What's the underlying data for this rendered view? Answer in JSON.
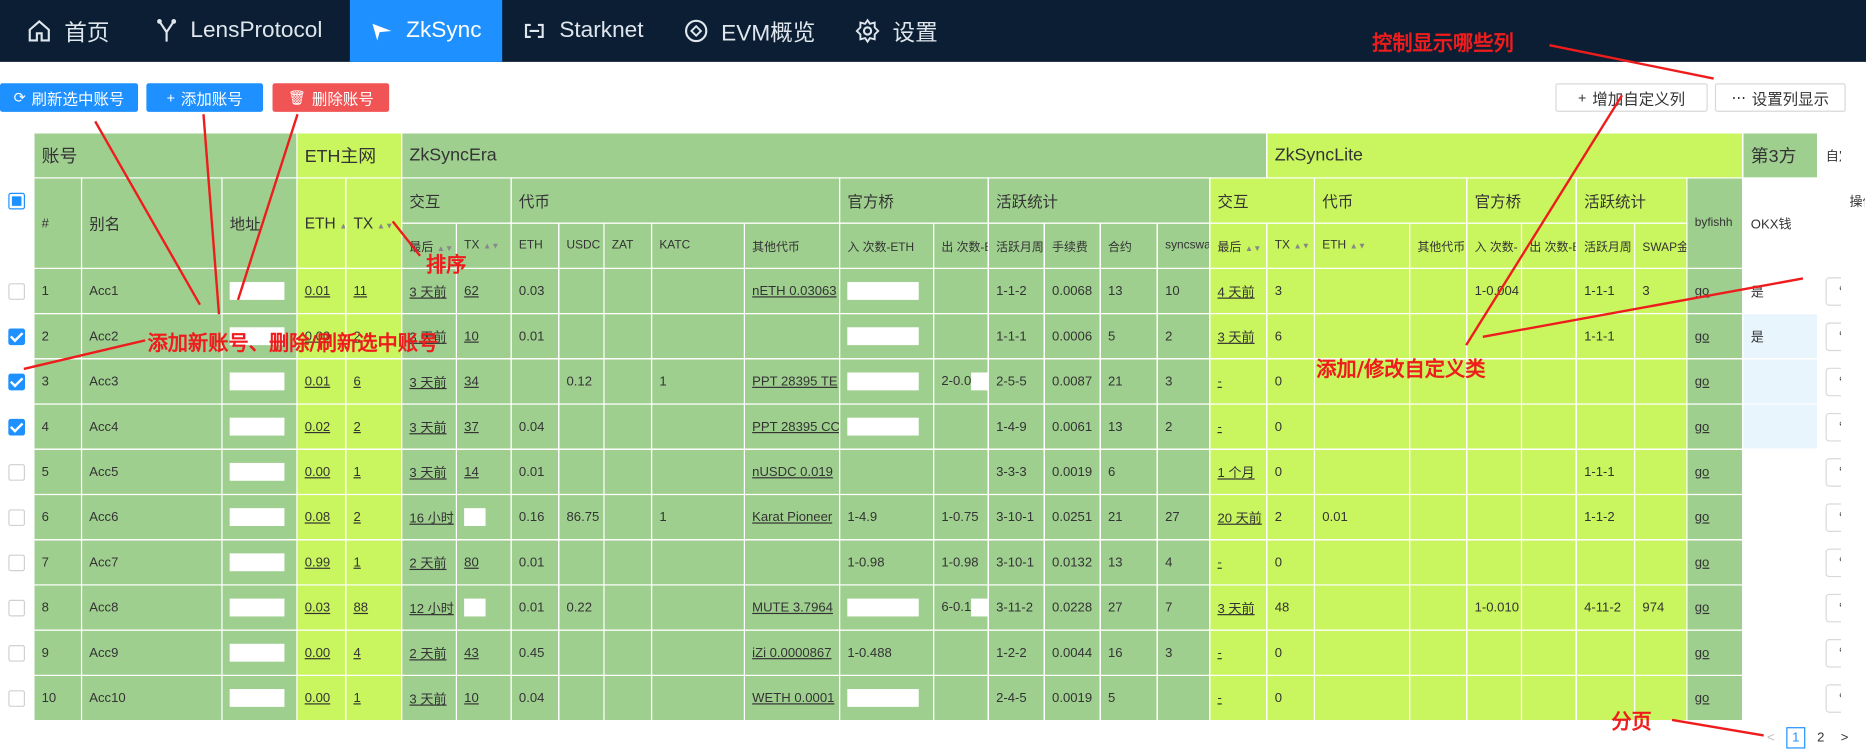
{
  "nav": {
    "items": [
      {
        "label": "首页",
        "icon": "home-icon"
      },
      {
        "label": "LensProtocol",
        "icon": "branch-icon"
      },
      {
        "label": "ZkSync",
        "icon": "send-icon"
      },
      {
        "label": "Starknet",
        "icon": "link-icon"
      },
      {
        "label": "EVM概览",
        "icon": "chip-icon"
      },
      {
        "label": "设置",
        "icon": "gear-icon"
      }
    ],
    "active": 2
  },
  "toolbar": {
    "refresh": "刷新选中账号",
    "add": "添加账号",
    "delete": "删除账号",
    "add_custom": "增加自定义列",
    "set_cols": "设置列显示"
  },
  "headers": {
    "account": "账号",
    "eth": "ETH主网",
    "era": "ZkSyncEra",
    "lite": "ZkSyncLite",
    "third": "第3方",
    "custom": "自定义",
    "ops": "操作",
    "idx": "#",
    "alias": "别名",
    "addr": "地址",
    "eth_bal": "ETH",
    "eth_tx": "TX",
    "era_inter": "交互",
    "era_token": "代币",
    "era_bridge": "官方桥",
    "era_active": "活跃统计",
    "lite_inter": "交互",
    "lite_token": "代币",
    "lite_bridge": "官方桥",
    "lite_active": "活跃统计",
    "byfishh": "byfishh",
    "okx": "OKX钱",
    "era_sub": [
      "最后",
      "TX",
      "ETH",
      "USDC",
      "ZAT",
      "KATC",
      "其他代币",
      "入 次数-ETH",
      "出 次数-ETH",
      "活跃月周",
      "手续费",
      "合约",
      "syncswap"
    ],
    "lite_sub": [
      "最后",
      "TX",
      "ETH",
      "其他代币",
      "入 次数-",
      "出 次数-ETH",
      "活跃月周",
      "SWAP金额"
    ]
  },
  "rows": [
    {
      "idx": "1",
      "alias": "Acc1",
      "eth": "0.01",
      "tx": "11",
      "last": "3 天前",
      "etx": "62",
      "eeth": "0.03",
      "usdc": "",
      "zat": "",
      "katc": "",
      "other": "nETH 0.03063",
      "bin": "",
      "bout": "",
      "act": "1-1-2",
      "fee": "0.0068",
      "con": "13",
      "swap": "10",
      "llast": "4 天前",
      "ltx": "3",
      "leth": "",
      "lother": "",
      "lin": "1-0.004",
      "lout": "",
      "lact": "1-1-1",
      "lswap": "3",
      "go": "go",
      "custom": "是",
      "checked": false
    },
    {
      "idx": "2",
      "alias": "Acc2",
      "eth": "0.00",
      "tx": "2",
      "last": "3 天前",
      "etx": "10",
      "eeth": "0.01",
      "usdc": "",
      "zat": "",
      "katc": "",
      "other": "",
      "bin": "",
      "bout": "",
      "act": "1-1-1",
      "fee": "0.0006",
      "con": "5",
      "swap": "2",
      "llast": "3 天前",
      "ltx": "6",
      "leth": "",
      "lother": "",
      "lin": "",
      "lout": "",
      "lact": "1-1-1",
      "lswap": "",
      "go": "go",
      "custom": "是",
      "checked": true
    },
    {
      "idx": "3",
      "alias": "Acc3",
      "eth": "0.01",
      "tx": "6",
      "last": "3 天前",
      "etx": "34",
      "eeth": "",
      "usdc": "0.12",
      "zat": "",
      "katc": "1",
      "other": "PPT 28395 TE",
      "bin": "",
      "bout": "2-0.0",
      "act": "2-5-5",
      "fee": "0.0087",
      "con": "21",
      "swap": "3",
      "llast": "-",
      "ltx": "0",
      "leth": "",
      "lother": "",
      "lin": "",
      "lout": "",
      "lact": "",
      "lswap": "",
      "go": "go",
      "custom": "",
      "checked": true
    },
    {
      "idx": "4",
      "alias": "Acc4",
      "eth": "0.02",
      "tx": "2",
      "last": "3 天前",
      "etx": "37",
      "eeth": "0.04",
      "usdc": "",
      "zat": "",
      "katc": "",
      "other": "PPT 28395 CC",
      "bin": "",
      "bout": "",
      "act": "1-4-9",
      "fee": "0.0061",
      "con": "13",
      "swap": "2",
      "llast": "-",
      "ltx": "0",
      "leth": "",
      "lother": "",
      "lin": "",
      "lout": "",
      "lact": "",
      "lswap": "",
      "go": "go",
      "custom": "",
      "checked": true
    },
    {
      "idx": "5",
      "alias": "Acc5",
      "eth": "0.00",
      "tx": "1",
      "last": "3 天前",
      "etx": "14",
      "eeth": "0.01",
      "usdc": "",
      "zat": "",
      "katc": "",
      "other": "nUSDC 0.019",
      "bin": "",
      "bout": "",
      "act": "3-3-3",
      "fee": "0.0019",
      "con": "6",
      "swap": "",
      "llast": "1 个月",
      "ltx": "0",
      "leth": "",
      "lother": "",
      "lin": "",
      "lout": "",
      "lact": "1-1-1",
      "lswap": "",
      "go": "go",
      "custom": "",
      "checked": false
    },
    {
      "idx": "6",
      "alias": "Acc6",
      "eth": "0.08",
      "tx": "2",
      "last": "16 小时",
      "etx": "",
      "eeth": "0.16",
      "usdc": "86.75",
      "zat": "",
      "katc": "1",
      "other": "Karat Pioneer",
      "bin": "1-4.9",
      "bout": "1-0.75",
      "act": "3-10-1",
      "fee": "0.0251",
      "con": "21",
      "swap": "27",
      "llast": "20 天前",
      "ltx": "2",
      "leth": "0.01",
      "lother": "",
      "lin": "",
      "lout": "",
      "lact": "1-1-2",
      "lswap": "",
      "go": "go",
      "custom": "",
      "checked": false
    },
    {
      "idx": "7",
      "alias": "Acc7",
      "eth": "0.99",
      "tx": "1",
      "last": "2 天前",
      "etx": "80",
      "eeth": "0.01",
      "usdc": "",
      "zat": "",
      "katc": "",
      "other": "",
      "bin": "1-0.98",
      "bout": "1-0.98",
      "act": "3-10-1",
      "fee": "0.0132",
      "con": "13",
      "swap": "4",
      "llast": "-",
      "ltx": "0",
      "leth": "",
      "lother": "",
      "lin": "",
      "lout": "",
      "lact": "",
      "lswap": "",
      "go": "go",
      "custom": "",
      "checked": false
    },
    {
      "idx": "8",
      "alias": "Acc8",
      "eth": "0.03",
      "tx": "88",
      "last": "12 小时",
      "etx": "",
      "eeth": "0.01",
      "usdc": "0.22",
      "zat": "",
      "katc": "",
      "other": "MUTE 3.7964",
      "bin": "",
      "bout": "6-0.1",
      "act": "3-11-2",
      "fee": "0.0228",
      "con": "27",
      "swap": "7",
      "llast": "3 天前",
      "ltx": "48",
      "leth": "",
      "lother": "",
      "lin": "1-0.010",
      "lout": "",
      "lact": "4-11-2",
      "lswap": "974",
      "go": "go",
      "custom": "",
      "checked": false
    },
    {
      "idx": "9",
      "alias": "Acc9",
      "eth": "0.00",
      "tx": "4",
      "last": "2 天前",
      "etx": "43",
      "eeth": "0.45",
      "usdc": "",
      "zat": "",
      "katc": "",
      "other": "iZi 0.0000867",
      "bin": "1-0.488",
      "bout": "",
      "act": "1-2-2",
      "fee": "0.0044",
      "con": "16",
      "swap": "3",
      "llast": "-",
      "ltx": "0",
      "leth": "",
      "lother": "",
      "lin": "",
      "lout": "",
      "lact": "",
      "lswap": "",
      "go": "go",
      "custom": "",
      "checked": false
    },
    {
      "idx": "10",
      "alias": "Acc10",
      "eth": "0.00",
      "tx": "1",
      "last": "3 天前",
      "etx": "10",
      "eeth": "0.04",
      "usdc": "",
      "zat": "",
      "katc": "",
      "other": "WETH 0.0001",
      "bin": "",
      "bout": "",
      "act": "2-4-5",
      "fee": "0.0019",
      "con": "5",
      "swap": "",
      "llast": "-",
      "ltx": "0",
      "leth": "",
      "lother": "",
      "lin": "",
      "lout": "",
      "lact": "",
      "lswap": "",
      "go": "go",
      "custom": "",
      "checked": false
    }
  ],
  "pager": {
    "prev": "<",
    "pages": [
      "1",
      "2"
    ],
    "current": "1",
    "next": ">"
  },
  "annotations": {
    "cols": "控制显示哪些列",
    "sort": "排序",
    "accounts": "添加新账号、删除/刷新选中账号",
    "custom": "添加/修改自定义类",
    "paging": "分页"
  },
  "colors": {
    "nav_bg": "#0b1e33",
    "accent": "#1e90ff",
    "danger": "#f05454",
    "era_green": "#9fcf8f",
    "lite_yellow": "#c9f55e",
    "annotation_red": "#ee1c1c"
  }
}
